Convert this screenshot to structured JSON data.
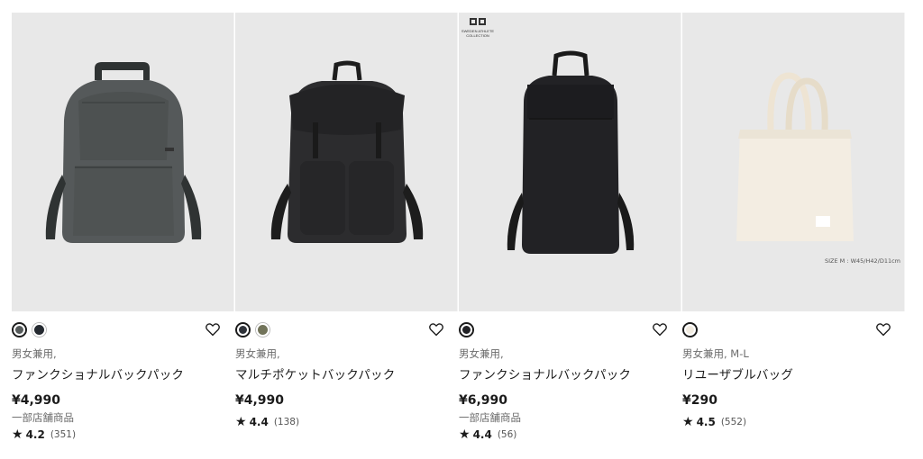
{
  "products": [
    {
      "gender": "男女兼用,",
      "name": "ファンクショナルバックパック",
      "price": "¥4,990",
      "store_note": "一部店舗商品",
      "rating_score": "4.2",
      "rating_count": "(351)",
      "colors": [
        "#555a5a",
        "#252a31"
      ],
      "favorite_icon": "heart-outline-icon"
    },
    {
      "gender": "男女兼用,",
      "name": "マルチポケットバックパック",
      "price": "¥4,990",
      "store_note": "",
      "rating_score": "4.4",
      "rating_count": "(138)",
      "colors": [
        "#2e3239",
        "#717359"
      ],
      "favorite_icon": "heart-outline-icon"
    },
    {
      "gender": "男女兼用,",
      "name": "ファンクショナルバックパック",
      "price": "¥6,990",
      "store_note": "一部店舗商品",
      "rating_score": "4.4",
      "rating_count": "(56)",
      "colors": [
        "#222226"
      ],
      "favorite_icon": "heart-outline-icon",
      "image_badge": [
        "SWEDEN ATHLETE",
        "COLLECTION"
      ]
    },
    {
      "gender": "男女兼用, M-L",
      "name": "リユーザブルバッグ",
      "price": "¥290",
      "store_note": "",
      "rating_score": "4.5",
      "rating_count": "(552)",
      "colors": [
        "#f1ebe0"
      ],
      "favorite_icon": "heart-outline-icon",
      "image_caption": "SIZE M : W45/H42/D11cm"
    }
  ],
  "rating_star": "★"
}
